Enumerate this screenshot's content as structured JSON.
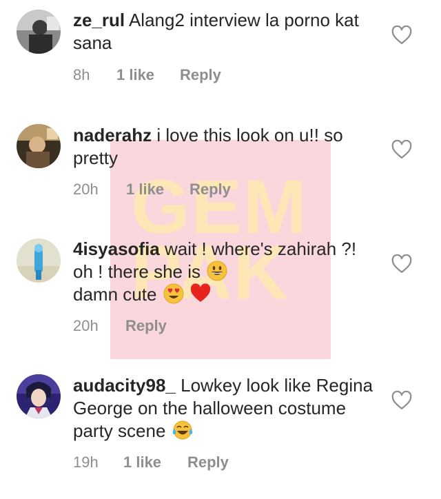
{
  "watermark": {
    "text": "GEM PAK"
  },
  "comments": [
    {
      "username": "ze_rul",
      "text": "Alang2 interview la porno kat sana",
      "time": "8h",
      "likes": "1 like",
      "reply": "Reply"
    },
    {
      "username": "naderahz",
      "text": "i love this look on u!! so pretty",
      "time": "20h",
      "likes": "1 like",
      "reply": "Reply"
    },
    {
      "username": "4isyasofia",
      "text_line1": "wait ! where's zahirah ?! oh ! there she is",
      "text_line2": "damn cute",
      "emojis": [
        "grinning-face",
        "heart-eyes-face",
        "red-heart"
      ],
      "time": "20h",
      "reply": "Reply"
    },
    {
      "username": "audacity98_",
      "text": "Lowkey look like Regina George on the halloween costume party scene",
      "emojis": [
        "tears-of-joy-face"
      ],
      "time": "19h",
      "likes": "1 like",
      "reply": "Reply"
    }
  ],
  "colors": {
    "text": "#262626",
    "meta": "#8e8e8e",
    "watermark_bg": "#f6b6c0",
    "watermark_text": "#ffecaa"
  },
  "icons": [
    "heart-outline-icon"
  ]
}
